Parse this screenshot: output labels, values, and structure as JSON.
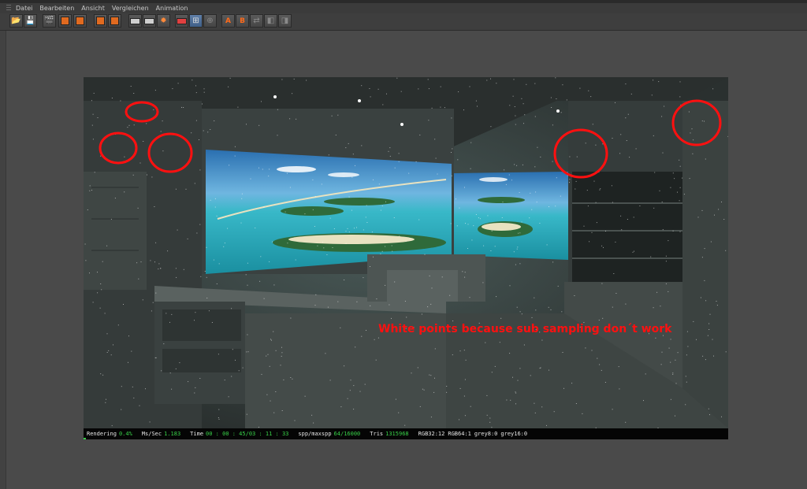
{
  "menu": [
    "Datei",
    "Bearbeiten",
    "Ansicht",
    "Vergleichen",
    "Animation"
  ],
  "toolbar": {
    "buttons": [
      {
        "name": "open-file-icon",
        "glyph": "📂"
      },
      {
        "name": "save-file-icon",
        "glyph": "💾"
      },
      {
        "name": "clapper-icon",
        "glyph": "🎬"
      },
      {
        "name": "render-region-icon",
        "glyph": "▣"
      },
      {
        "name": "render-settings-icon",
        "glyph": "▤"
      },
      {
        "name": "snapshot-icon",
        "glyph": "▦"
      },
      {
        "name": "copy-image-icon",
        "glyph": "▧"
      },
      {
        "name": "display-region-icon",
        "glyph": "▢"
      },
      {
        "name": "camera-icon",
        "glyph": "◙"
      },
      {
        "name": "gear-icon",
        "glyph": "✹"
      },
      {
        "name": "compare-icon",
        "glyph": "◫"
      },
      {
        "name": "fit-view-icon",
        "glyph": "⊞"
      },
      {
        "name": "zoom-icon",
        "glyph": "⊕"
      },
      {
        "name": "compare-a-icon",
        "glyph": "A"
      },
      {
        "name": "compare-b-icon",
        "glyph": "B"
      },
      {
        "name": "swap-icon",
        "glyph": "⇄"
      },
      {
        "name": "split-icon",
        "glyph": "◧"
      },
      {
        "name": "diff-icon",
        "glyph": "◨"
      }
    ]
  },
  "annotation": "White points because sub sampling don´t work",
  "status": {
    "rendering_label": "Rendering",
    "rendering_value": "0.4%",
    "ms_label": "Ms/Sec",
    "ms_value": "1.183",
    "time_label": "Time",
    "time_value": "00 : 00 : 45/03 : 11 : 33",
    "spp_label": "spp/maxspp",
    "spp_value": "64/16000",
    "tris_label": "Tris",
    "tris_value": "1315968",
    "rgb32": "RGB32:12",
    "rgb64": "RGB64:1",
    "grey8": "grey8:0",
    "grey16": "grey16:0",
    "progress": 0.004
  },
  "colors": {
    "accent_green": "#38d048",
    "annotation_red": "#ff1010"
  }
}
